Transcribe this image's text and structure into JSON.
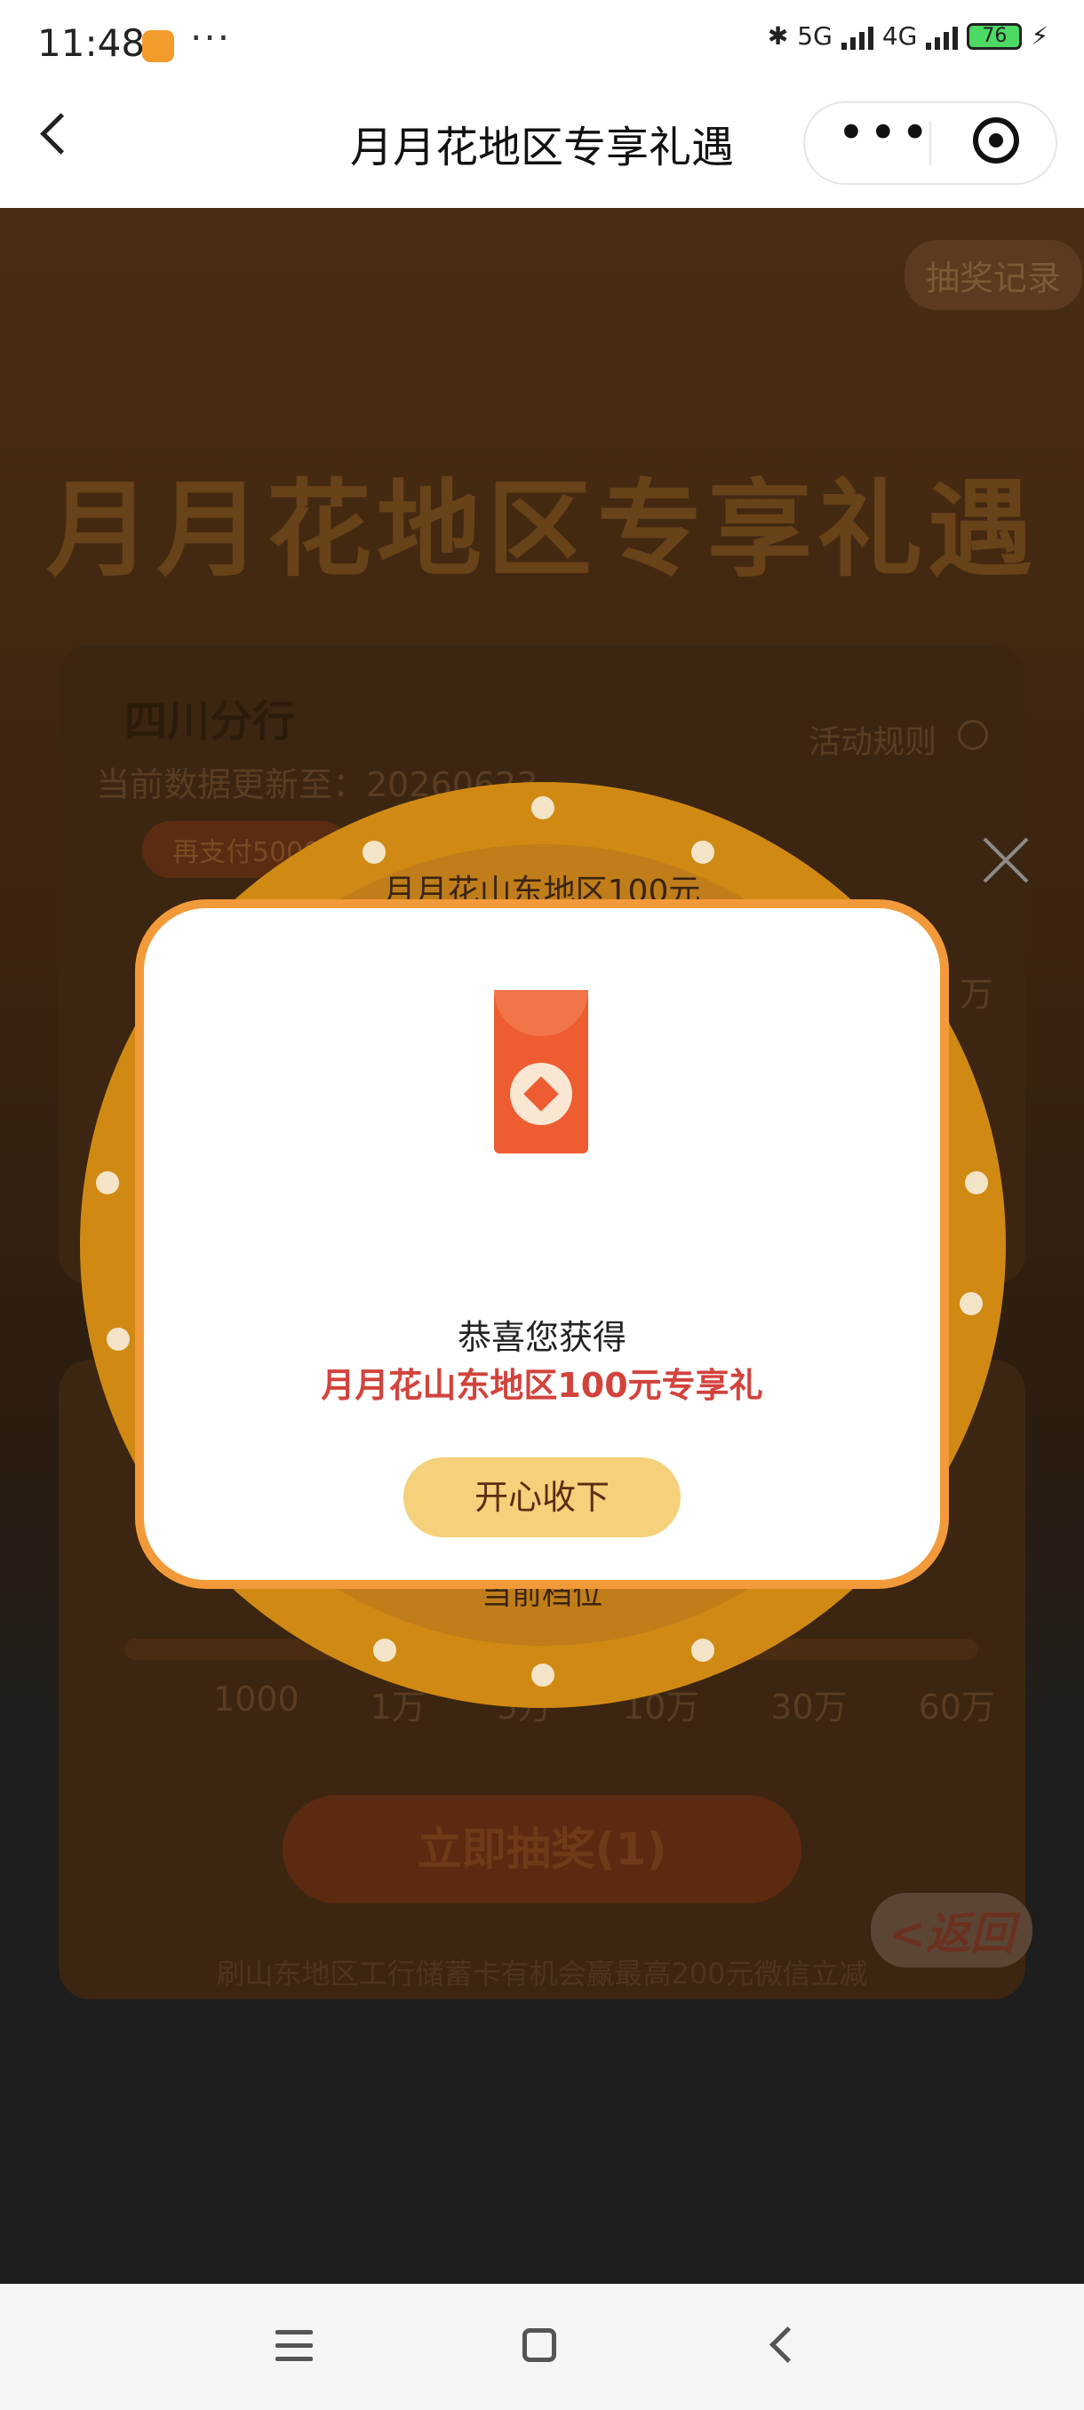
{
  "status_bar": {
    "time": "11:48",
    "dots": "···",
    "network_5g": "5G",
    "network_4g": "4G",
    "battery": "76"
  },
  "nav": {
    "title": "月月花地区专享礼遇",
    "more": "•••"
  },
  "page": {
    "record_button": "抽奖记录",
    "main_title": "月月花地区专享礼遇",
    "branch": "四川分行",
    "rules": "活动规则",
    "update_text": "当前数据更新至：20260623",
    "pay_badge": "再支付5000",
    "wan_right": "万",
    "milestones": [
      "1000",
      "1万",
      "5万",
      "10万",
      "30万",
      "60万"
    ],
    "draw_button": "立即抽奖(1)",
    "footer_note": "刷山东地区工行储蓄卡有机会赢最高200元微信立减",
    "return_badge": "<返回"
  },
  "wheel": {
    "prize": "月月花山东地区100元",
    "sub": "当前档位"
  },
  "modal": {
    "congrats": "恭喜您获得",
    "prize": "月月花山东地区100元专享礼",
    "accept_button": "开心收下"
  }
}
